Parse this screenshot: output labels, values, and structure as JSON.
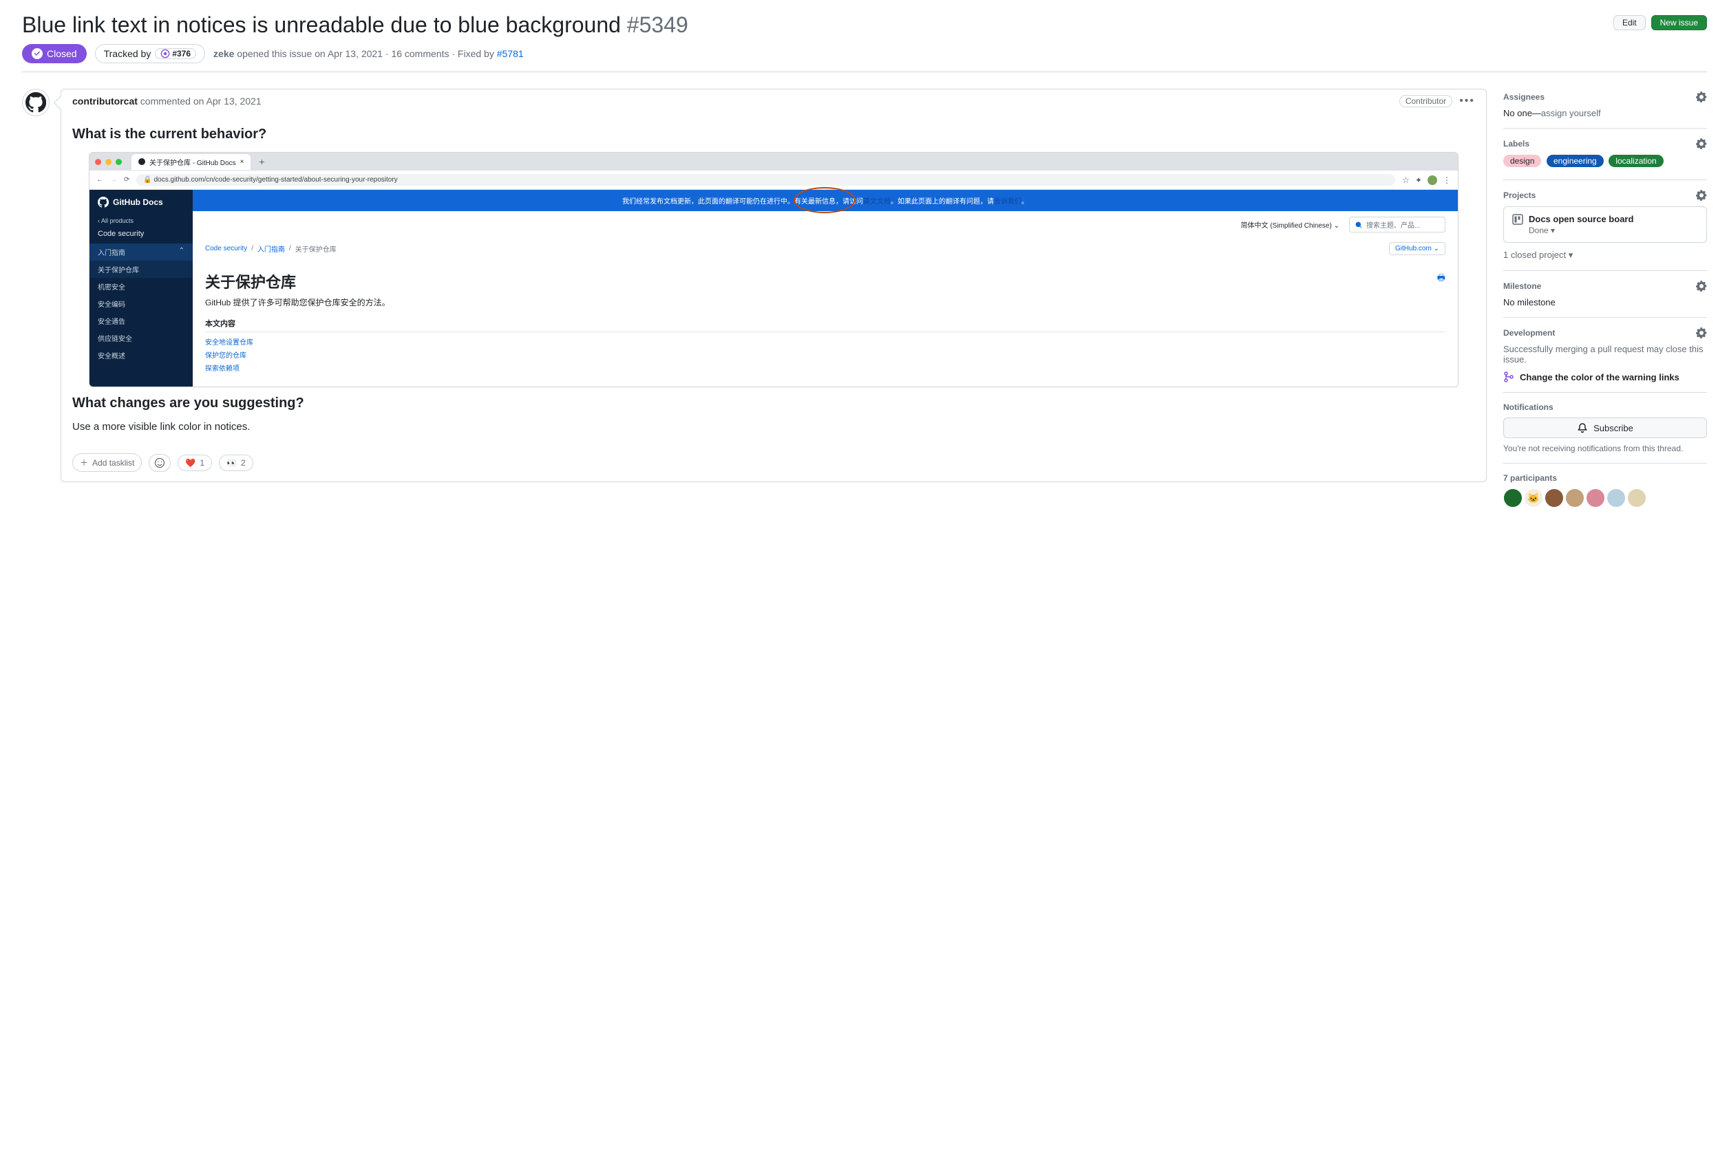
{
  "header": {
    "title": "Blue link text in notices is unreadable due to blue background",
    "issue_number": "#5349",
    "edit_btn": "Edit",
    "new_issue_btn": "New issue",
    "state": "Closed",
    "tracked_by_label": "Tracked by",
    "tracked_by_ref": "#376",
    "author": "zeke",
    "opened_text": " opened this issue on Apr 13, 2021 · 16 comments · Fixed by ",
    "fixed_by": "#5781"
  },
  "comment": {
    "author": "contributorcat",
    "action_text": " commented ",
    "date": "on Apr 13, 2021",
    "role": "Contributor",
    "h1": "What is the current behavior?",
    "h2": "What changes are you suggesting?",
    "change_text": "Use a more visible link color in notices.",
    "add_tasklist": "Add tasklist",
    "react_heart_count": "1",
    "react_eyes_count": "2"
  },
  "screenshot": {
    "tab_title": "关于保护仓库 - GitHub Docs",
    "url": "docs.github.com/cn/code-security/getting-started/about-securing-your-repository",
    "brand": "GitHub Docs",
    "all_products": "‹  All products",
    "section": "Code security",
    "nav": [
      "入门指南",
      "关于保护仓库",
      "机密安全",
      "安全编码",
      "安全通告",
      "供应链安全",
      "安全概述"
    ],
    "banner_a": "我们经常发布文档更新，此页面的翻译可能仍在进行中。有关最新信息，",
    "banner_b": "请访问",
    "banner_c": "英文文档",
    "banner_d": "。如果此页面上的翻译有问题，请",
    "banner_e": "告诉我们",
    "banner_f": "。",
    "lang": "简体中文 (Simplified Chinese)",
    "search_ph": "搜索主题、产品...",
    "bc1": "Code security",
    "bc2": "入门指南",
    "bc3": "关于保护仓库",
    "gh_btn": "GitHub.com",
    "page_h1": "关于保护仓库",
    "page_sub": "GitHub 提供了许多可帮助您保护仓库安全的方法。",
    "toc_h": "本文内容",
    "toc": [
      "安全地设置仓库",
      "保护您的仓库",
      "探索依赖项"
    ]
  },
  "sidebar": {
    "assignees_h": "Assignees",
    "assignees_none": "No one—",
    "assign_self": "assign yourself",
    "labels_h": "Labels",
    "labels": {
      "design": "design",
      "eng": "engineering",
      "loc": "localization"
    },
    "projects_h": "Projects",
    "project_name": "Docs open source board",
    "project_status": "Done",
    "closed_projects": "1 closed project",
    "milestone_h": "Milestone",
    "milestone_none": "No milestone",
    "dev_h": "Development",
    "dev_text": "Successfully merging a pull request may close this issue.",
    "dev_pr": "Change the color of the warning links",
    "notif_h": "Notifications",
    "subscribe": "Subscribe",
    "notif_sub": "You're not receiving notifications from this thread.",
    "participants_h": "7 participants"
  }
}
